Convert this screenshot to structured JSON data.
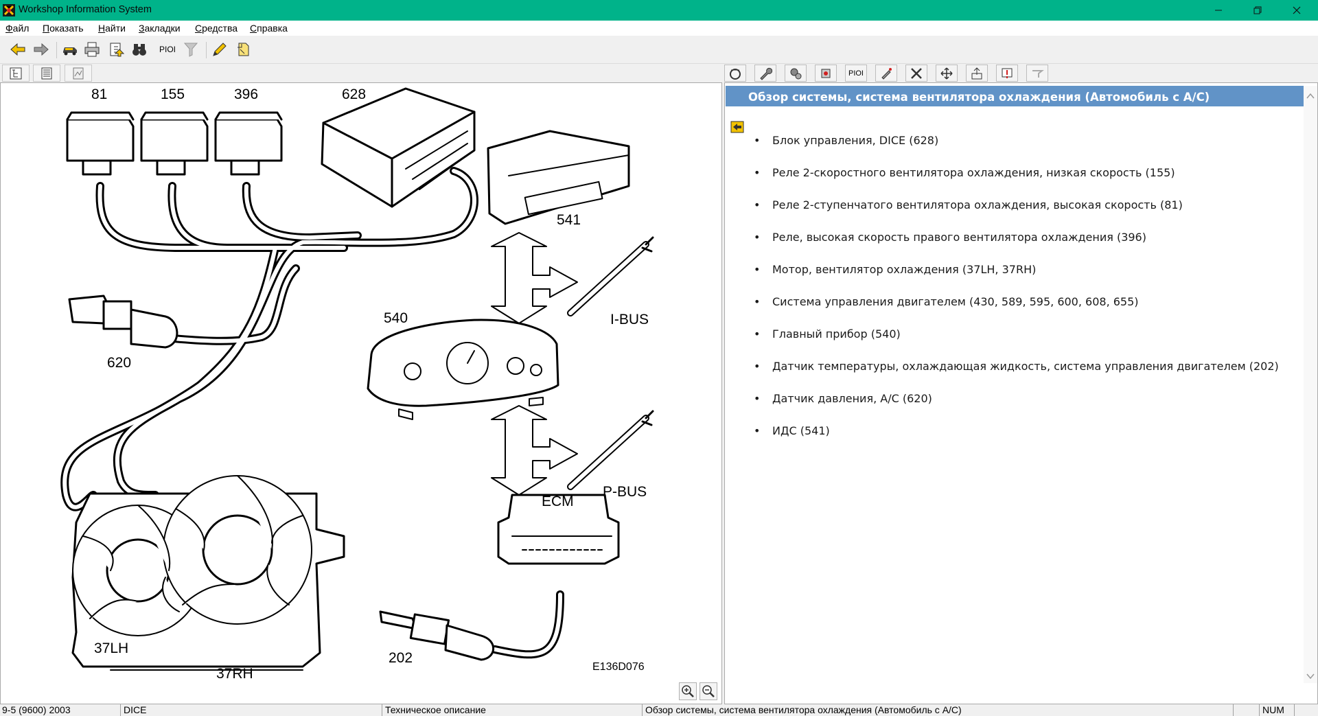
{
  "window": {
    "title": "Workshop Information System",
    "titlebar_color": "#00b38a",
    "controls": [
      "minimize-icon",
      "restore-icon",
      "close-icon"
    ]
  },
  "menu": [
    {
      "label": "Файл"
    },
    {
      "label": "Показать"
    },
    {
      "label": "Найти"
    },
    {
      "label": "Закладки"
    },
    {
      "label": "Средства"
    },
    {
      "label": "Справка"
    }
  ],
  "toolbar": {
    "back_icon": "arrow-left-icon",
    "forward_icon": "arrow-right-icon",
    "car_icon": "car-icon",
    "print_icon": "printer-icon",
    "save_icon": "save-icon",
    "find_icon": "binoculars-icon",
    "pi_label": "PIOI",
    "filter_icon": "filter-icon",
    "bookmark_icon": "pencil-icon",
    "note_icon": "note-icon"
  },
  "right_tabs": {
    "pi_label": "PIOI",
    "icons": [
      "tire-icon",
      "wrench-icon",
      "gears-icon",
      "engine-icon",
      "pi-icon",
      "spark-icon",
      "tools-icon",
      "move-icon",
      "install-icon",
      "warning-icon",
      "hook-icon"
    ]
  },
  "diagram": {
    "image_id": "E136D076",
    "labels": {
      "r81": "81",
      "r155": "155",
      "r396": "396",
      "dice": "628",
      "ids": "541",
      "sensor620": "620",
      "cluster": "540",
      "ibus": "I-BUS",
      "pbus": "P-BUS",
      "ecm": "ECM",
      "fan_lh": "37LH",
      "fan_rh": "37RH",
      "sensor202": "202"
    }
  },
  "document": {
    "title": "Обзор системы, система вентилятора охлаждения (Автомобиль с A/C)",
    "header_color": "#6193c7",
    "items": [
      "Блок управления, DICE (628)",
      "Реле 2-скоростного вентилятора охлаждения, низкая скорость (155)",
      "Реле 2-ступенчатого вентилятора охлаждения, высокая скорость (81)",
      "Реле, высокая скорость правого вентилятора охлаждения (396)",
      "Мотор, вентилятор охлаждения (37LH, 37RH)",
      "Система управления двигателем (430, 589, 595, 600, 608, 655)",
      "Главный прибор (540)",
      "Датчик температуры, охлаждающая жидкость, система управления двигателем (202)",
      "Датчик давления, A/C (620)",
      "ИДС (541)"
    ]
  },
  "status": {
    "model": "9-5 (9600) 2003",
    "system": "DICE",
    "info_type": "Техническое описание",
    "doc_title": "Обзор системы, система вентилятора охлаждения (Автомобиль с A/C)",
    "num": "NUM"
  }
}
